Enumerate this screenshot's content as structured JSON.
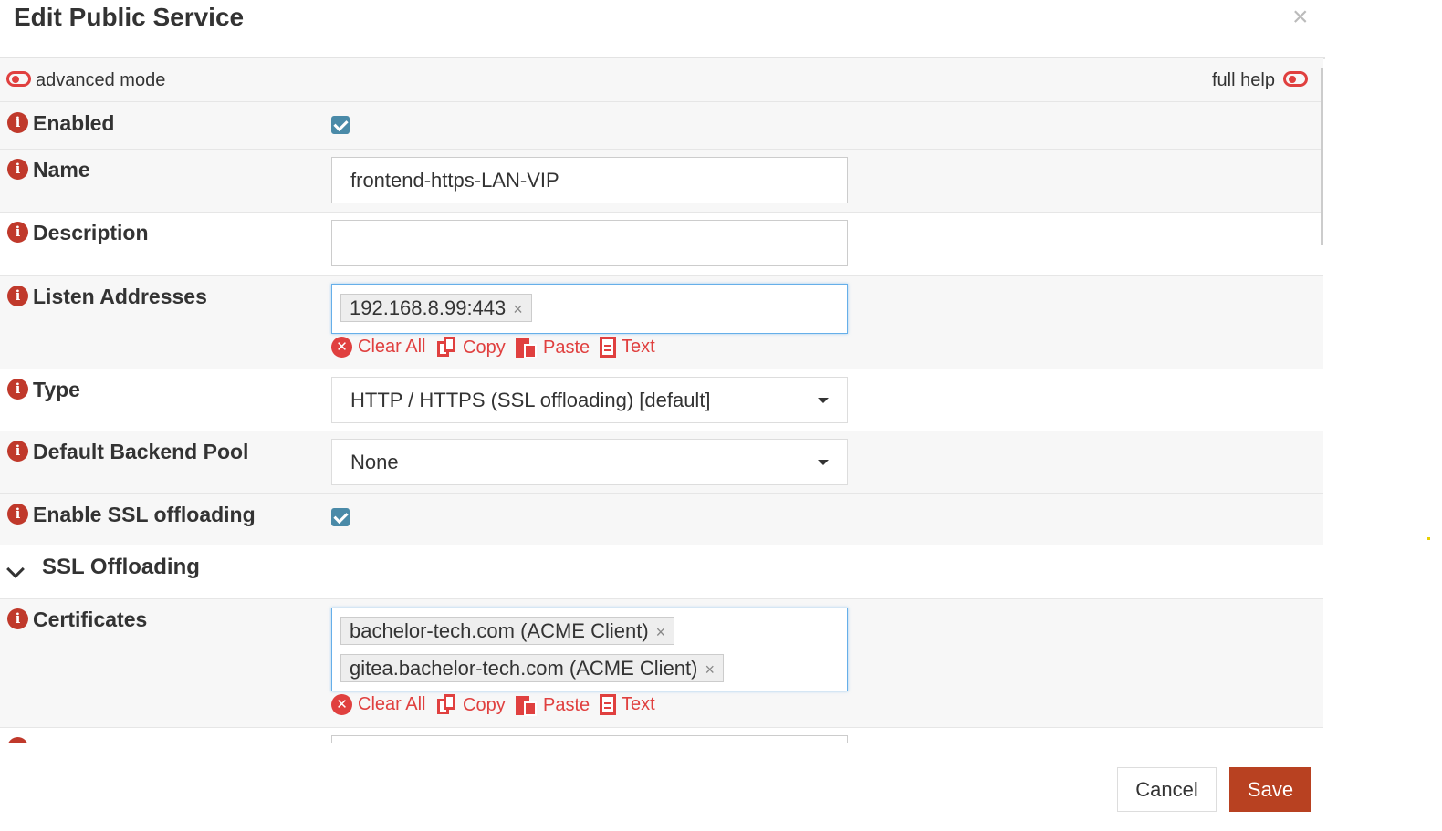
{
  "dialog": {
    "title": "Edit Public Service",
    "close_glyph": "×"
  },
  "topbar": {
    "advanced_mode_label": "advanced mode",
    "full_help_label": "full help"
  },
  "fields": {
    "enabled": {
      "label": "Enabled",
      "checked": true
    },
    "name": {
      "label": "Name",
      "value": "frontend-https-LAN-VIP"
    },
    "description": {
      "label": "Description",
      "value": ""
    },
    "listen_addresses": {
      "label": "Listen Addresses",
      "tags": [
        "192.168.8.99:443"
      ]
    },
    "type": {
      "label": "Type",
      "selected": "HTTP / HTTPS (SSL offloading) [default]"
    },
    "default_backend_pool": {
      "label": "Default Backend Pool",
      "selected": "None"
    },
    "enable_ssl_offloading": {
      "label": "Enable SSL offloading",
      "checked": true
    },
    "certificates": {
      "label": "Certificates",
      "tags": [
        "bachelor-tech.com (ACME Client)",
        "gitea.bachelor-tech.com (ACME Client)"
      ]
    }
  },
  "section": {
    "title": "SSL Offloading"
  },
  "tag_tools": {
    "clear_all": "Clear All",
    "copy": "Copy",
    "paste": "Paste",
    "text": "Text",
    "remove_glyph": "×"
  },
  "info_glyph": "i",
  "footer": {
    "cancel_label": "Cancel",
    "save_label": "Save"
  },
  "colors": {
    "accent_red": "#e0403f",
    "info_icon": "#c0392b",
    "save_button": "#b84121",
    "checkbox": "#4a8aa8"
  }
}
